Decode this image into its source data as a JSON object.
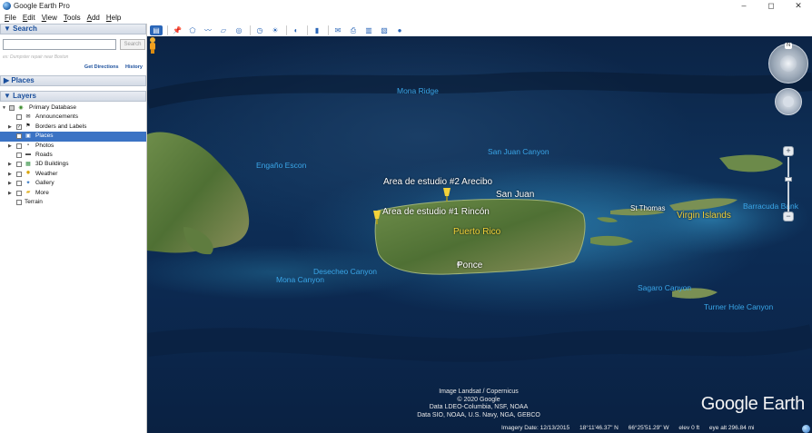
{
  "window": {
    "title": "Google Earth Pro",
    "controls": [
      "–",
      "◻",
      "✕"
    ]
  },
  "menu": [
    "File",
    "Edit",
    "View",
    "Tools",
    "Add",
    "Help"
  ],
  "search": {
    "header": "▼ Search",
    "placeholder": "",
    "button": "Search",
    "hint": "ex: Dumpster repair near Boston",
    "links": [
      "Get Directions",
      "History"
    ]
  },
  "places": {
    "header": "▶ Places"
  },
  "layers": {
    "header": "▼ Layers",
    "items": [
      {
        "label": "Primary Database",
        "icon": "globe-folder-icon",
        "expanded": true,
        "checked": "partial"
      },
      {
        "label": "Announcements",
        "icon": "mail-icon",
        "checked": false
      },
      {
        "label": "Borders and Labels",
        "icon": "flag-icon",
        "checked": true
      },
      {
        "label": "Places",
        "icon": "places-icon",
        "checked": false,
        "selected": true
      },
      {
        "label": "Photos",
        "icon": "camera-icon",
        "checked": false
      },
      {
        "label": "Roads",
        "icon": "road-icon",
        "checked": false
      },
      {
        "label": "3D Buildings",
        "icon": "building-icon",
        "checked": false
      },
      {
        "label": "Weather",
        "icon": "sun-icon",
        "checked": false
      },
      {
        "label": "Gallery",
        "icon": "gallery-icon",
        "checked": false
      },
      {
        "label": "More",
        "icon": "folder-icon",
        "checked": false
      },
      {
        "label": "Terrain",
        "icon": "",
        "checked": false
      }
    ]
  },
  "toolbar": {
    "buttons": [
      "sidebar-toggle-icon",
      "placemark-icon",
      "polygon-icon",
      "path-icon",
      "image-overlay-icon",
      "tour-icon",
      "historical-imagery-icon",
      "sunlight-icon",
      "planets-icon",
      "ruler-icon",
      "email-icon",
      "print-icon",
      "save-image-icon",
      "maps-icon",
      "earth-sphere-icon"
    ]
  },
  "map": {
    "sea_labels": [
      "Mona Ridge",
      "San Juan Canyon",
      "Engaño Escon",
      "Desecheo Canyon",
      "Mona Canyon",
      "Sagaro Canyon",
      "Turner Hole Canyon",
      "Barracuda Bank"
    ],
    "places": {
      "study2": "Area de estudio #2 Arecibo",
      "study1": "Area de estudio #1 Rincón",
      "san_juan": "San Juan",
      "puerto_rico": "Puerto Rico",
      "ponce": "Ponce",
      "st_thomas": "St Thomas",
      "virgin_islands": "Virgin Islands"
    },
    "attribution": [
      "Image Landsat / Copernicus",
      "© 2020 Google",
      "Data LDEO-Columbia, NSF, NOAA",
      "Data SIO, NOAA, U.S. Navy, NGA, GEBCO"
    ],
    "logo": "Google Earth",
    "status": {
      "imagery_date": "Imagery Date: 12/13/2015",
      "lat": "18°11'46.37\" N",
      "lon": "66°25'51.29\" W",
      "elev": "elev    0 ft",
      "eye": "eye alt 296.84 mi"
    }
  }
}
